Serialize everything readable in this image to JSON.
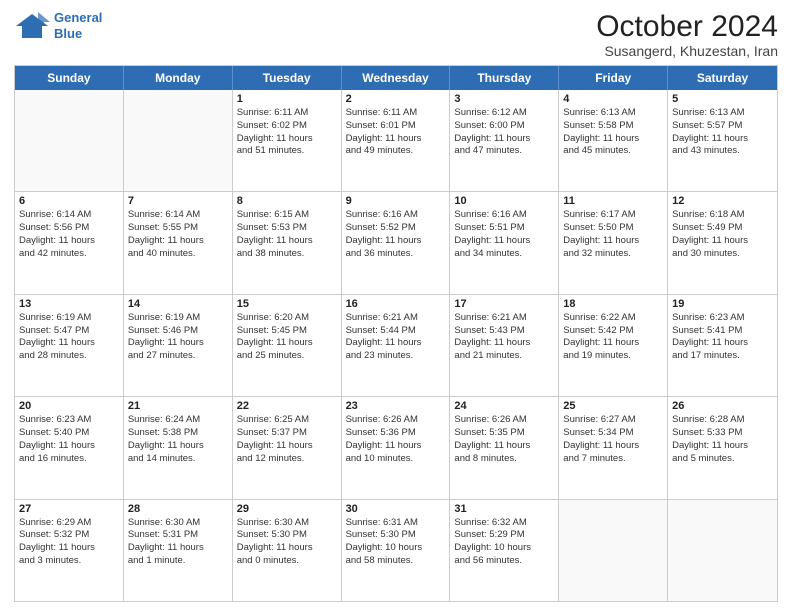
{
  "header": {
    "logo_line1": "General",
    "logo_line2": "Blue",
    "title": "October 2024",
    "subtitle": "Susangerd, Khuzestan, Iran"
  },
  "weekdays": [
    "Sunday",
    "Monday",
    "Tuesday",
    "Wednesday",
    "Thursday",
    "Friday",
    "Saturday"
  ],
  "rows": [
    [
      {
        "day": "",
        "lines": []
      },
      {
        "day": "",
        "lines": []
      },
      {
        "day": "1",
        "lines": [
          "Sunrise: 6:11 AM",
          "Sunset: 6:02 PM",
          "Daylight: 11 hours",
          "and 51 minutes."
        ]
      },
      {
        "day": "2",
        "lines": [
          "Sunrise: 6:11 AM",
          "Sunset: 6:01 PM",
          "Daylight: 11 hours",
          "and 49 minutes."
        ]
      },
      {
        "day": "3",
        "lines": [
          "Sunrise: 6:12 AM",
          "Sunset: 6:00 PM",
          "Daylight: 11 hours",
          "and 47 minutes."
        ]
      },
      {
        "day": "4",
        "lines": [
          "Sunrise: 6:13 AM",
          "Sunset: 5:58 PM",
          "Daylight: 11 hours",
          "and 45 minutes."
        ]
      },
      {
        "day": "5",
        "lines": [
          "Sunrise: 6:13 AM",
          "Sunset: 5:57 PM",
          "Daylight: 11 hours",
          "and 43 minutes."
        ]
      }
    ],
    [
      {
        "day": "6",
        "lines": [
          "Sunrise: 6:14 AM",
          "Sunset: 5:56 PM",
          "Daylight: 11 hours",
          "and 42 minutes."
        ]
      },
      {
        "day": "7",
        "lines": [
          "Sunrise: 6:14 AM",
          "Sunset: 5:55 PM",
          "Daylight: 11 hours",
          "and 40 minutes."
        ]
      },
      {
        "day": "8",
        "lines": [
          "Sunrise: 6:15 AM",
          "Sunset: 5:53 PM",
          "Daylight: 11 hours",
          "and 38 minutes."
        ]
      },
      {
        "day": "9",
        "lines": [
          "Sunrise: 6:16 AM",
          "Sunset: 5:52 PM",
          "Daylight: 11 hours",
          "and 36 minutes."
        ]
      },
      {
        "day": "10",
        "lines": [
          "Sunrise: 6:16 AM",
          "Sunset: 5:51 PM",
          "Daylight: 11 hours",
          "and 34 minutes."
        ]
      },
      {
        "day": "11",
        "lines": [
          "Sunrise: 6:17 AM",
          "Sunset: 5:50 PM",
          "Daylight: 11 hours",
          "and 32 minutes."
        ]
      },
      {
        "day": "12",
        "lines": [
          "Sunrise: 6:18 AM",
          "Sunset: 5:49 PM",
          "Daylight: 11 hours",
          "and 30 minutes."
        ]
      }
    ],
    [
      {
        "day": "13",
        "lines": [
          "Sunrise: 6:19 AM",
          "Sunset: 5:47 PM",
          "Daylight: 11 hours",
          "and 28 minutes."
        ]
      },
      {
        "day": "14",
        "lines": [
          "Sunrise: 6:19 AM",
          "Sunset: 5:46 PM",
          "Daylight: 11 hours",
          "and 27 minutes."
        ]
      },
      {
        "day": "15",
        "lines": [
          "Sunrise: 6:20 AM",
          "Sunset: 5:45 PM",
          "Daylight: 11 hours",
          "and 25 minutes."
        ]
      },
      {
        "day": "16",
        "lines": [
          "Sunrise: 6:21 AM",
          "Sunset: 5:44 PM",
          "Daylight: 11 hours",
          "and 23 minutes."
        ]
      },
      {
        "day": "17",
        "lines": [
          "Sunrise: 6:21 AM",
          "Sunset: 5:43 PM",
          "Daylight: 11 hours",
          "and 21 minutes."
        ]
      },
      {
        "day": "18",
        "lines": [
          "Sunrise: 6:22 AM",
          "Sunset: 5:42 PM",
          "Daylight: 11 hours",
          "and 19 minutes."
        ]
      },
      {
        "day": "19",
        "lines": [
          "Sunrise: 6:23 AM",
          "Sunset: 5:41 PM",
          "Daylight: 11 hours",
          "and 17 minutes."
        ]
      }
    ],
    [
      {
        "day": "20",
        "lines": [
          "Sunrise: 6:23 AM",
          "Sunset: 5:40 PM",
          "Daylight: 11 hours",
          "and 16 minutes."
        ]
      },
      {
        "day": "21",
        "lines": [
          "Sunrise: 6:24 AM",
          "Sunset: 5:38 PM",
          "Daylight: 11 hours",
          "and 14 minutes."
        ]
      },
      {
        "day": "22",
        "lines": [
          "Sunrise: 6:25 AM",
          "Sunset: 5:37 PM",
          "Daylight: 11 hours",
          "and 12 minutes."
        ]
      },
      {
        "day": "23",
        "lines": [
          "Sunrise: 6:26 AM",
          "Sunset: 5:36 PM",
          "Daylight: 11 hours",
          "and 10 minutes."
        ]
      },
      {
        "day": "24",
        "lines": [
          "Sunrise: 6:26 AM",
          "Sunset: 5:35 PM",
          "Daylight: 11 hours",
          "and 8 minutes."
        ]
      },
      {
        "day": "25",
        "lines": [
          "Sunrise: 6:27 AM",
          "Sunset: 5:34 PM",
          "Daylight: 11 hours",
          "and 7 minutes."
        ]
      },
      {
        "day": "26",
        "lines": [
          "Sunrise: 6:28 AM",
          "Sunset: 5:33 PM",
          "Daylight: 11 hours",
          "and 5 minutes."
        ]
      }
    ],
    [
      {
        "day": "27",
        "lines": [
          "Sunrise: 6:29 AM",
          "Sunset: 5:32 PM",
          "Daylight: 11 hours",
          "and 3 minutes."
        ]
      },
      {
        "day": "28",
        "lines": [
          "Sunrise: 6:30 AM",
          "Sunset: 5:31 PM",
          "Daylight: 11 hours",
          "and 1 minute."
        ]
      },
      {
        "day": "29",
        "lines": [
          "Sunrise: 6:30 AM",
          "Sunset: 5:30 PM",
          "Daylight: 11 hours",
          "and 0 minutes."
        ]
      },
      {
        "day": "30",
        "lines": [
          "Sunrise: 6:31 AM",
          "Sunset: 5:30 PM",
          "Daylight: 10 hours",
          "and 58 minutes."
        ]
      },
      {
        "day": "31",
        "lines": [
          "Sunrise: 6:32 AM",
          "Sunset: 5:29 PM",
          "Daylight: 10 hours",
          "and 56 minutes."
        ]
      },
      {
        "day": "",
        "lines": []
      },
      {
        "day": "",
        "lines": []
      }
    ]
  ]
}
